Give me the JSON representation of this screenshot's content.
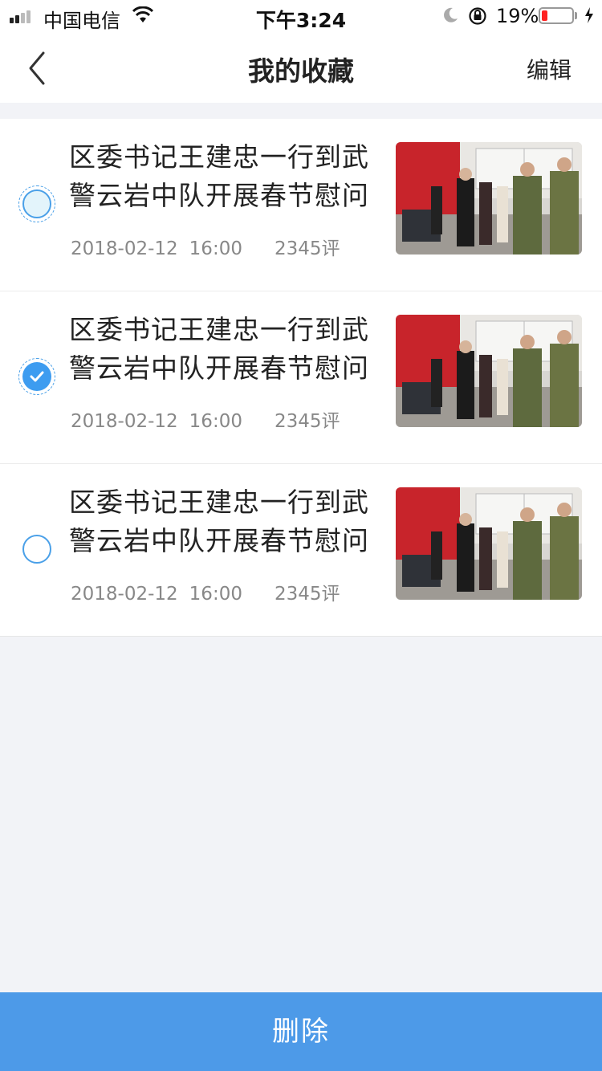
{
  "status": {
    "carrier": "中国电信",
    "time": "下午3:24",
    "battery_percent": "19%",
    "battery_level": 0.19
  },
  "nav": {
    "title": "我的收藏",
    "edit_label": "编辑"
  },
  "items": [
    {
      "title": "区委书记王建忠一行到武警云岩中队开展春节慰问",
      "date": "2018-02-12",
      "time": "16:00",
      "comments": "2345评",
      "selected": false
    },
    {
      "title": "区委书记王建忠一行到武警云岩中队开展春节慰问",
      "date": "2018-02-12",
      "time": "16:00",
      "comments": "2345评",
      "selected": true
    },
    {
      "title": "区委书记王建忠一行到武警云岩中队开展春节慰问",
      "date": "2018-02-12",
      "time": "16:00",
      "comments": "2345评",
      "selected": false
    }
  ],
  "footer": {
    "delete_label": "删除"
  },
  "colors": {
    "accent": "#4d9ae8",
    "check": "#3d9cf0",
    "battery_low": "#ff2222"
  }
}
